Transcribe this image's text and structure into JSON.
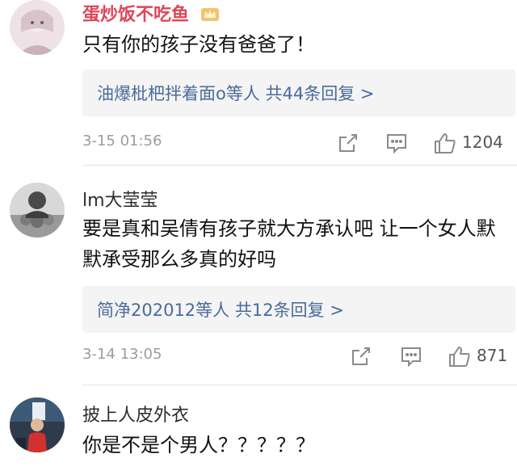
{
  "comments": [
    {
      "username": "蛋炒饭不吃鱼",
      "text": "只有你的孩子没有爸爸了！",
      "reply_summary": "油爆枇杷拌着面o等人  共44条回复 >",
      "time": "3-15 01:56",
      "likes": "1204"
    },
    {
      "username": "lm大莹莹",
      "text": "要是真和吴倩有孩子就大方承认吧 让一个女人默默承受那么多真的好吗",
      "reply_summary": "简净202012等人  共12条回复 >",
      "time": "3-14 13:05",
      "likes": "871"
    },
    {
      "username": "披上人皮外衣",
      "text": "你是不是个男人？？？？？"
    }
  ],
  "icons": {
    "share": "share-icon",
    "comment": "comment-icon",
    "like": "thumbs-up-icon",
    "badge": "crown-badge-icon"
  },
  "colors": {
    "vip_username": "#e0445a",
    "reply_link": "#4a6b9a",
    "meta_gray": "#9c9c9c",
    "reply_bg": "#f4f4f4"
  }
}
